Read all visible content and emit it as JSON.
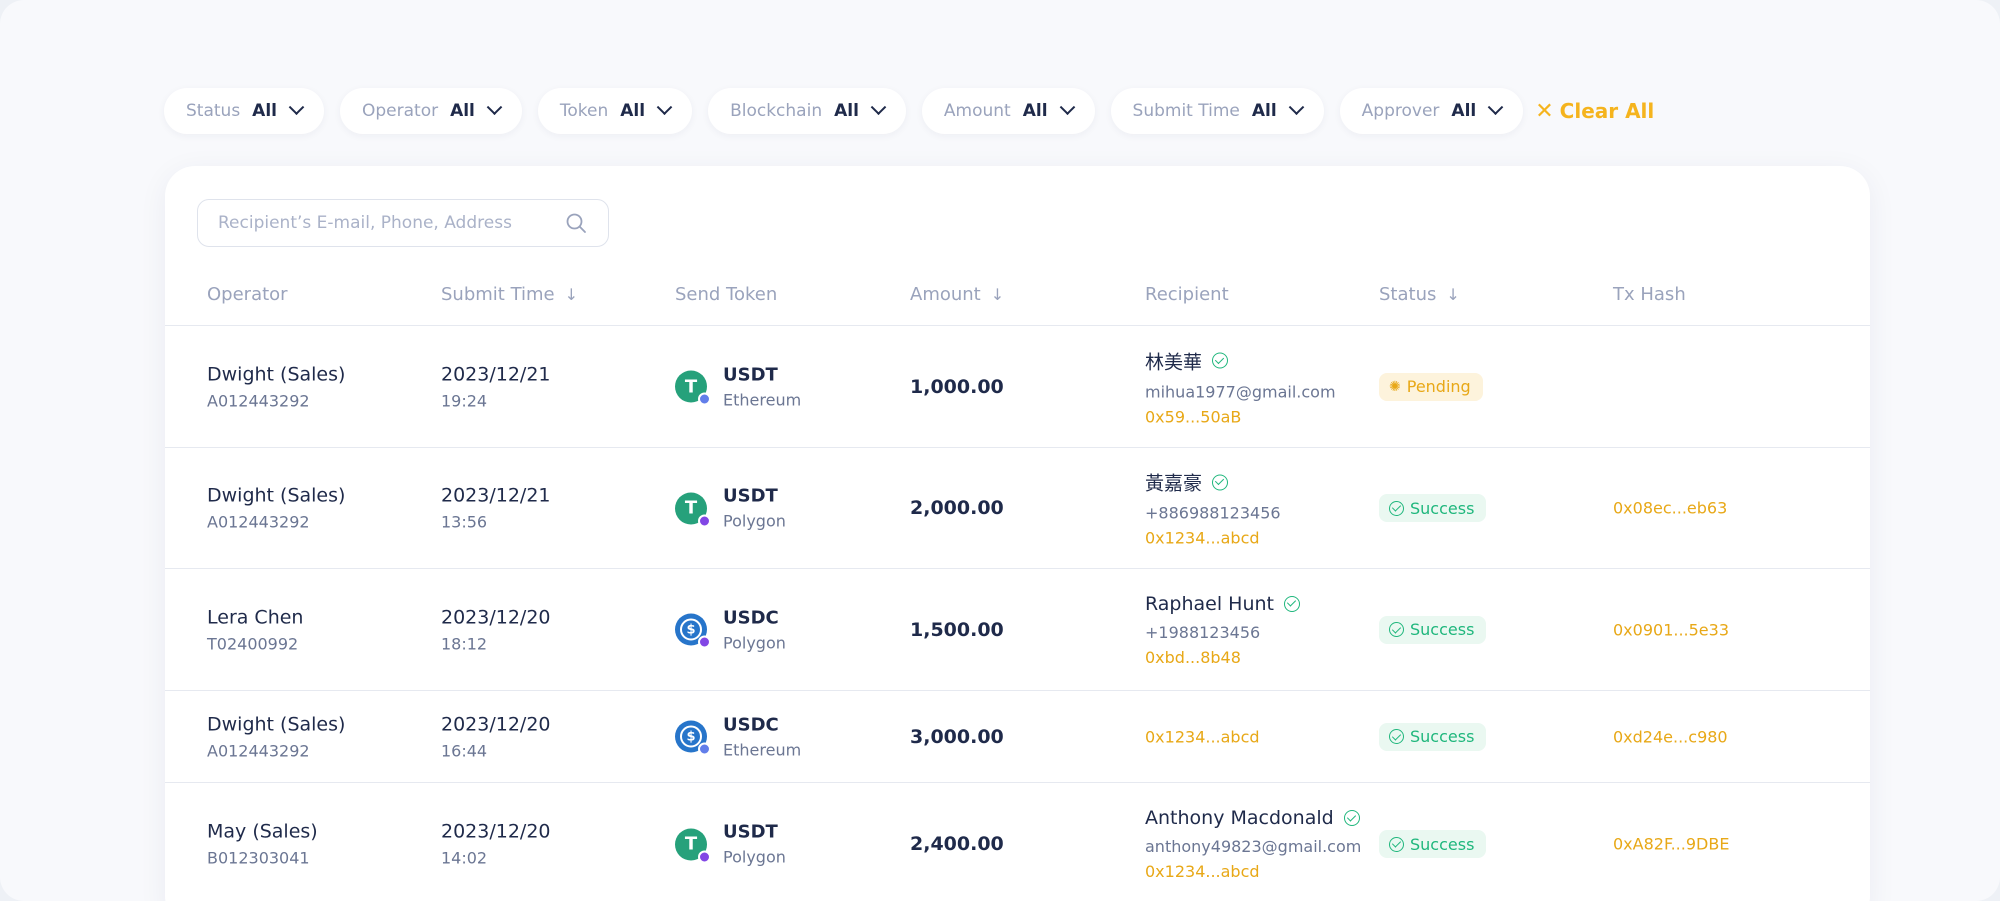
{
  "filters": [
    {
      "label": "Status",
      "value": "All",
      "name": "status"
    },
    {
      "label": "Operator",
      "value": "All",
      "name": "operator"
    },
    {
      "label": "Token",
      "value": "All",
      "name": "token"
    },
    {
      "label": "Blockchain",
      "value": "All",
      "name": "blockchain"
    },
    {
      "label": "Amount",
      "value": "All",
      "name": "amount"
    },
    {
      "label": "Submit Time",
      "value": "All",
      "name": "submit-time"
    },
    {
      "label": "Approver",
      "value": "All",
      "name": "approver"
    }
  ],
  "clear_all": {
    "icon": "close-icon",
    "label": "Clear All"
  },
  "search": {
    "placeholder": "Recipient’s E-mail, Phone, Address",
    "icon": "search-icon"
  },
  "columns": {
    "operator": "Operator",
    "submit_time": "Submit Time",
    "send_token": "Send Token",
    "amount": "Amount",
    "recipient": "Recipient",
    "status": "Status",
    "tx_hash": "Tx Hash"
  },
  "colors": {
    "accent": "#f5b41e",
    "success": "#20b77d",
    "pending": "#e8a817",
    "usdt": "#26a17b",
    "usdc": "#2775ca"
  },
  "rows": [
    {
      "operator": "Dwight (Sales)",
      "operator_id": "A012443292",
      "date": "2023/12/21",
      "time": "19:24",
      "token": "USDT",
      "token_glyph": "T",
      "chain": "Ethereum",
      "amount": "1,000.00",
      "recipient_name": "林美華",
      "recipient_contact": "mihua1977@gmail.com",
      "recipient_address": "0x59...50aB",
      "status": "Pending",
      "tx_hash": ""
    },
    {
      "operator": "Dwight (Sales)",
      "operator_id": "A012443292",
      "date": "2023/12/21",
      "time": "13:56",
      "token": "USDT",
      "token_glyph": "T",
      "chain": "Polygon",
      "amount": "2,000.00",
      "recipient_name": "黃嘉豪",
      "recipient_contact": "+886988123456",
      "recipient_address": "0x1234...abcd",
      "status": "Success",
      "tx_hash": "0x08ec...eb63"
    },
    {
      "operator": "Lera Chen",
      "operator_id": "T02400992",
      "date": "2023/12/20",
      "time": "18:12",
      "token": "USDC",
      "token_glyph": "$",
      "chain": "Polygon",
      "amount": "1,500.00",
      "recipient_name": "Raphael Hunt",
      "recipient_contact": "+1988123456",
      "recipient_address": "0xbd...8b48",
      "status": "Success",
      "tx_hash": "0x0901...5e33"
    },
    {
      "operator": "Dwight (Sales)",
      "operator_id": "A012443292",
      "date": "2023/12/20",
      "time": "16:44",
      "token": "USDC",
      "token_glyph": "$",
      "chain": "Ethereum",
      "amount": "3,000.00",
      "recipient_name": "",
      "recipient_contact": "",
      "recipient_address": "0x1234...abcd",
      "status": "Success",
      "tx_hash": "0xd24e...c980"
    },
    {
      "operator": "May (Sales)",
      "operator_id": "B012303041",
      "date": "2023/12/20",
      "time": "14:02",
      "token": "USDT",
      "token_glyph": "T",
      "chain": "Polygon",
      "amount": "2,400.00",
      "recipient_name": "Anthony Macdonald",
      "recipient_contact": "anthony49823@gmail.com",
      "recipient_address": "0x1234...abcd",
      "status": "Success",
      "tx_hash": "0xA82F...9DBE"
    }
  ]
}
